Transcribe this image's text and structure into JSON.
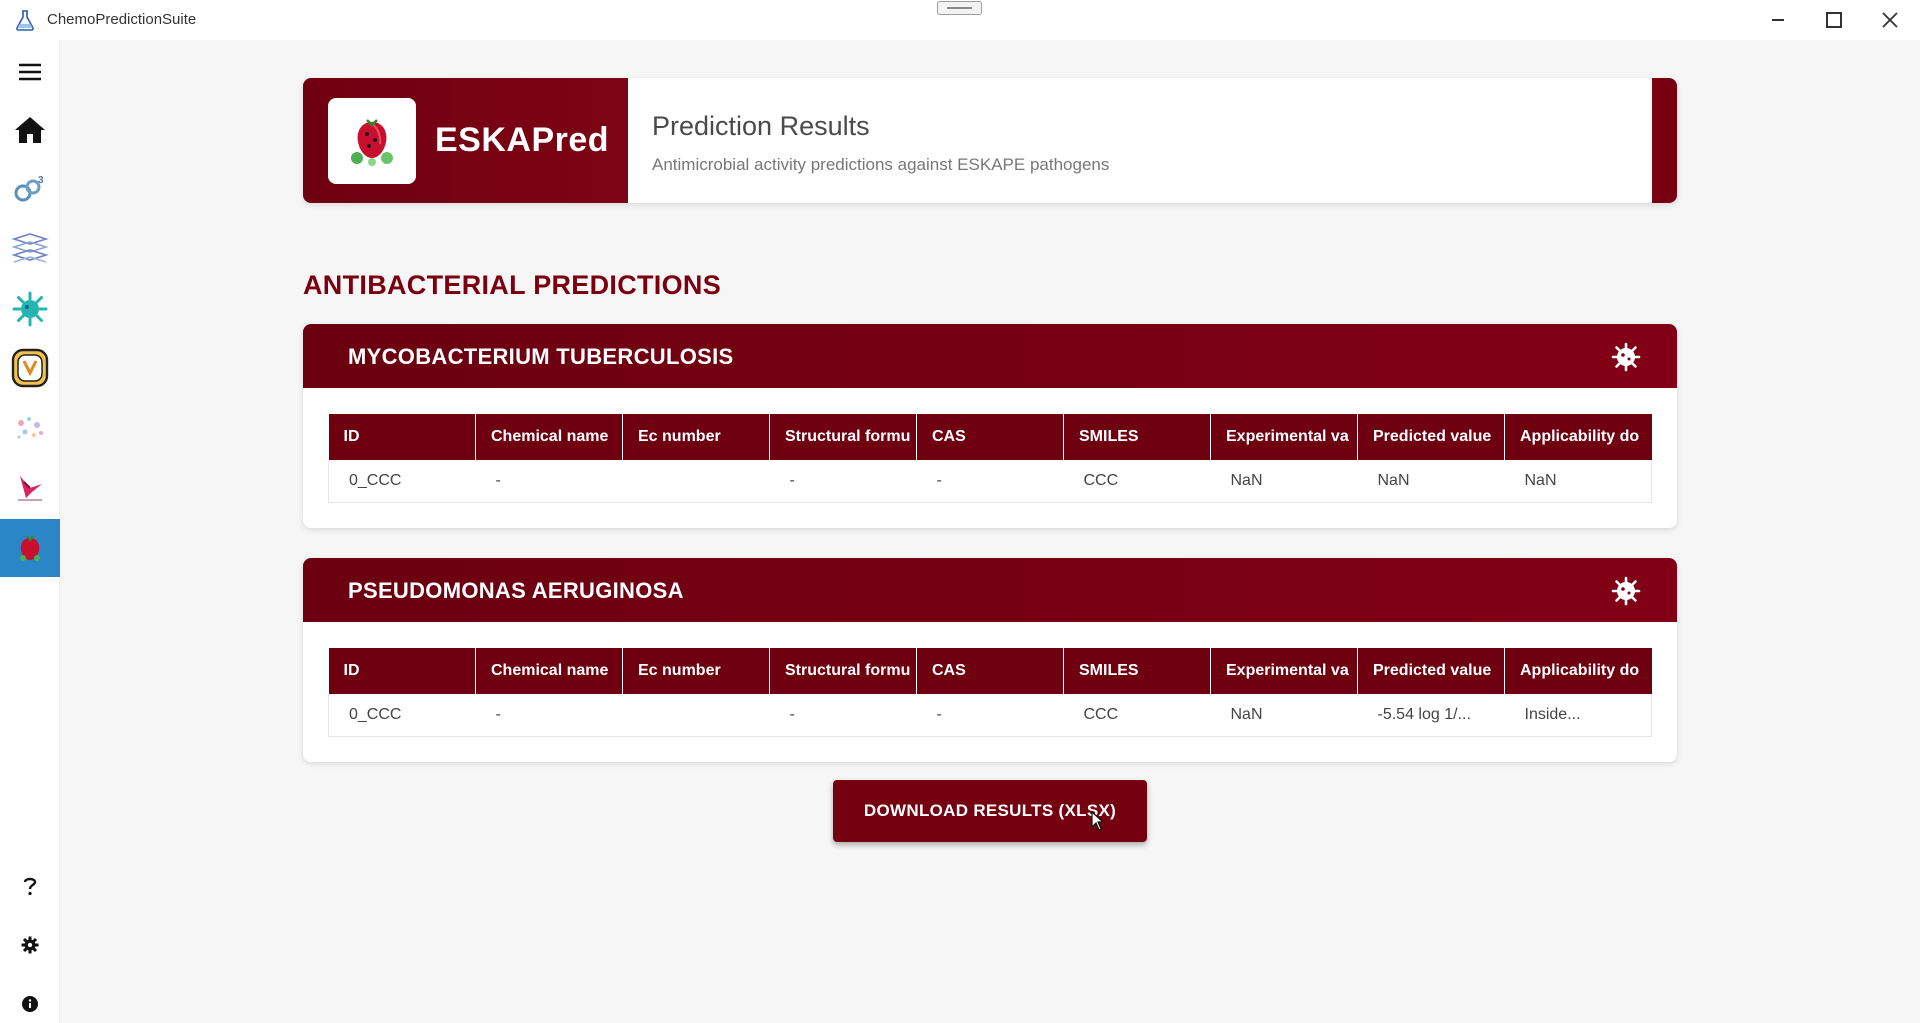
{
  "window": {
    "title": "ChemoPredictionSuite",
    "app_icon": "flask-icon",
    "controls": [
      "minimize-icon",
      "maximize-icon",
      "close-icon"
    ]
  },
  "sidebar": {
    "items": [
      {
        "name": "menu",
        "icon": "hamburger-icon"
      },
      {
        "name": "home",
        "icon": "home-icon"
      },
      {
        "name": "module-1",
        "icon": "molecule-icon"
      },
      {
        "name": "module-2",
        "icon": "layers-icon"
      },
      {
        "name": "module-3",
        "icon": "virus-icon"
      },
      {
        "name": "module-4",
        "icon": "shield-app-icon"
      },
      {
        "name": "module-5",
        "icon": "particles-icon"
      },
      {
        "name": "module-6",
        "icon": "bird-icon"
      },
      {
        "name": "eskapred",
        "icon": "eskapred-icon",
        "active": true
      },
      {
        "name": "help",
        "icon": "help-icon"
      },
      {
        "name": "settings",
        "icon": "gear-icon"
      },
      {
        "name": "info",
        "icon": "info-icon"
      }
    ]
  },
  "header": {
    "brand_name": "ESKAPred",
    "title": "Prediction Results",
    "subtitle": "Antimicrobial activity predictions against ESKAPE pathogens"
  },
  "section": {
    "title": "ANTIBACTERIAL PREDICTIONS"
  },
  "columns": [
    "ID",
    "Chemical name",
    "Ec number",
    "Structural formu",
    "CAS",
    "SMILES",
    "Experimental va",
    "Predicted value",
    "Applicability do"
  ],
  "pathogens": [
    {
      "title": "MYCOBACTERIUM TUBERCULOSIS",
      "icon": "bacteria-icon",
      "rows": [
        [
          "0_CCC",
          "-",
          "",
          "-",
          "-",
          "CCC",
          "NaN",
          "NaN",
          "NaN"
        ]
      ]
    },
    {
      "title": "PSEUDOMONAS AERUGINOSA",
      "icon": "bacteria-icon",
      "rows": [
        [
          "0_CCC",
          "-",
          "",
          "-",
          "-",
          "CCC",
          "NaN",
          "-5.54 log 1/...",
          "Inside..."
        ]
      ]
    }
  ],
  "actions": {
    "download_label": "DOWNLOAD RESULTS (XLSX)"
  },
  "colors": {
    "brand": "#740010",
    "active_nav": "#2a86c6"
  }
}
